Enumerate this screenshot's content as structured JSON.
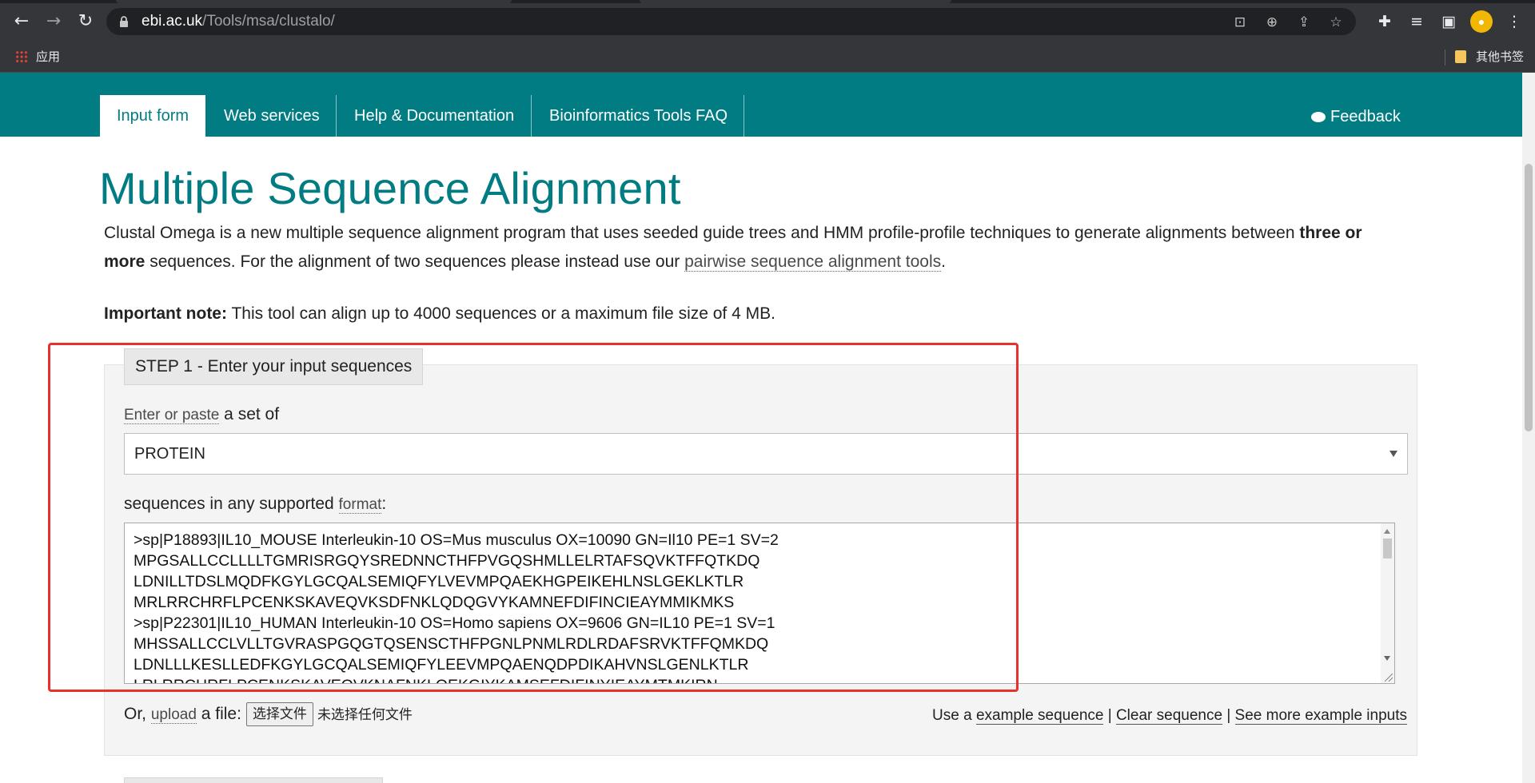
{
  "browser": {
    "url_host": "ebi.ac.uk",
    "url_path": "/Tools/msa/clustalo/",
    "bookmarks": {
      "apps_label": "应用",
      "other_label": "其他书签"
    }
  },
  "nav": {
    "tabs": [
      {
        "label": "Input form",
        "active": true
      },
      {
        "label": "Web services"
      },
      {
        "label": "Help & Documentation"
      },
      {
        "label": "Bioinformatics Tools FAQ"
      }
    ],
    "feedback_label": "Feedback"
  },
  "page": {
    "title": "Multiple Sequence Alignment",
    "intro_pre": "Clustal Omega is a new multiple sequence alignment program that uses seeded guide trees and HMM profile-profile techniques to generate alignments between ",
    "intro_bold": "three or more",
    "intro_mid": " sequences. For the alignment of two sequences please instead use our ",
    "intro_link": "pairwise sequence alignment tools",
    "intro_end": ".",
    "note_bold": "Important note:",
    "note_text": " This tool can align up to 4000 sequences or a maximum file size of 4 MB."
  },
  "step1": {
    "legend": "STEP 1 - Enter your input sequences",
    "enter_link": "Enter or paste",
    "enter_rest": " a set of",
    "seqtype_value": "PROTEIN",
    "format_pre": "sequences in any supported ",
    "format_link": "format",
    "format_post": ":",
    "sequence_lines": [
      ">sp|P18893|IL10_MOUSE Interleukin-10 OS=Mus musculus OX=10090 GN=Il10 PE=1 SV=2",
      "MPGSALLCCLLLLTGMRISRGQYSREDNNCTHFPVGQSHMLLELRTAFSQVKTFFQTKDQ",
      "LDNILLTDSLMQDFKGYLGCQALSEMIQFYLVEVMPQAEKHGPEIKEHLNSLGEKLKTLR",
      "MRLRRCHRFLPCENKSKAVEQVKSDFNKLQDQGVYKAMNEFDIFINCIEAYMMIKMKS",
      ">sp|P22301|IL10_HUMAN Interleukin-10 OS=Homo sapiens OX=9606 GN=IL10 PE=1 SV=1",
      "MHSSALLCCLVLLTGVRASPGQGTQSENSCTHFPGNLPNMLRDLRDAFSRVKTFFQMKDQ",
      "LDNLLLKESLLEDFKGYLGCQALSEMIQFYLEEVMPQAENQDPDIKAHVNSLGENLKTLR",
      "LRLRRCHRFLPCENKSKAVEQVKNAFNKLQEKGIYKAMSEFDIFINYIEAYMTMKIRN"
    ],
    "upload_pre": "Or, ",
    "upload_link": "upload",
    "upload_post": " a file:",
    "choose_file_label": "选择文件",
    "no_file_label": "未选择任何文件",
    "examples": {
      "use_pre": "Use a ",
      "example_link": "example sequence",
      "sep1": " | ",
      "clear_link": "Clear sequence",
      "sep2": " | ",
      "more_link": "See more example inputs"
    }
  },
  "colors": {
    "brand": "#007c82",
    "highlight": "#e8302c"
  }
}
